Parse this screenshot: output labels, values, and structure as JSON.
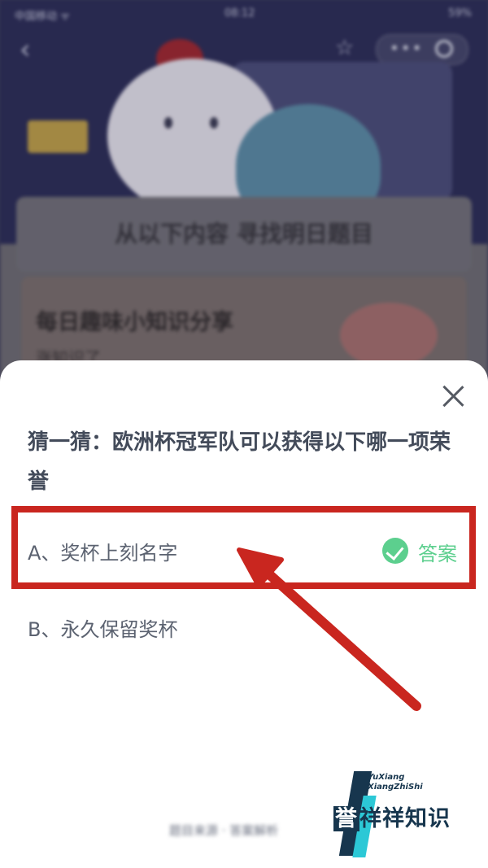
{
  "status_bar": {
    "carrier": "中国移动 ᯤ",
    "time": "08:12",
    "battery": "59%"
  },
  "background": {
    "banner_text": "从以下内容 寻找明日题目",
    "share_title": "每日趣味小知识分享",
    "share_subtitle": "涨知识了"
  },
  "sheet": {
    "question": "猜一猜：欧洲杯冠军队可以获得以下哪一项荣誉",
    "options": [
      {
        "label": "A、奖杯上刻名字",
        "is_answer": true,
        "answer_label": "答案"
      },
      {
        "label": "B、永久保留奖杯",
        "is_answer": false
      }
    ],
    "footer": "题目来源 · 答案解析"
  },
  "colors": {
    "annotation_red": "#c9261f",
    "answer_green": "#5ccf8e",
    "question_text": "#434b5a"
  },
  "watermark": {
    "en_line1": "YuXiang",
    "en_line2": "XiangZhiShi",
    "cn_first": "誉",
    "cn_rest": "祥祥知识"
  }
}
